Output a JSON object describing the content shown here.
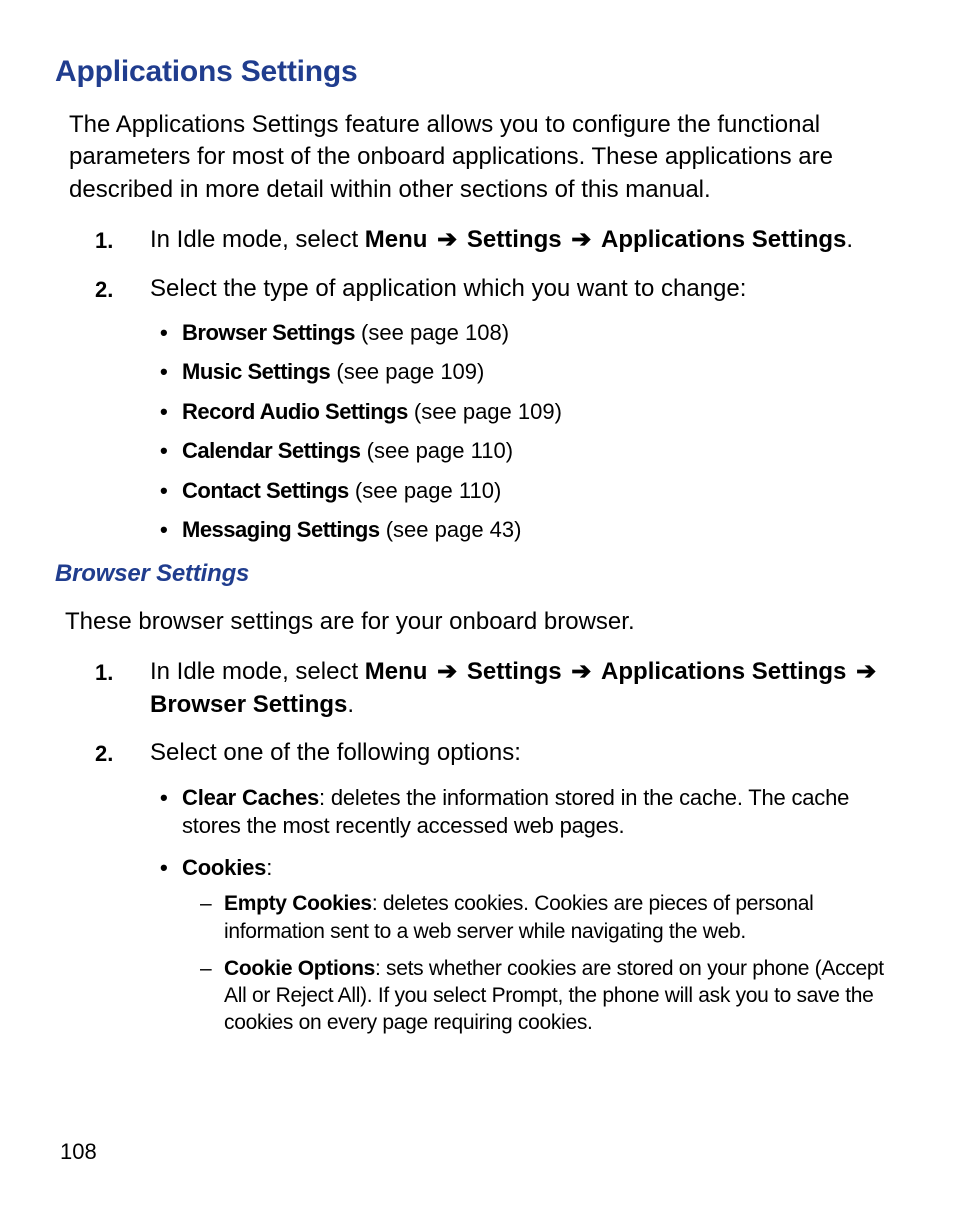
{
  "heading": "Applications Settings",
  "intro": "The Applications Settings feature allows you to configure the functional parameters for most of the onboard applications. These applications are described in more detail within other sections of this manual.",
  "arrow": "➔",
  "step1": {
    "num": "1.",
    "lead": "In Idle mode, select ",
    "menu": "Menu",
    "settings": "Settings",
    "apps": "Applications Settings",
    "tail": "."
  },
  "step2": {
    "num": "2.",
    "text": "Select the type of application which you want to change:"
  },
  "types": [
    {
      "name": "Browser Settings",
      "ref": " (see page 108)"
    },
    {
      "name": "Music Settings",
      "ref": " (see page 109)"
    },
    {
      "name": "Record Audio Settings",
      "ref": " (see page 109)"
    },
    {
      "name": "Calendar Settings",
      "ref": " (see page 110)"
    },
    {
      "name": "Contact Settings",
      "ref": " (see page 110)"
    },
    {
      "name": "Messaging Settings",
      "ref": " (see page 43)"
    }
  ],
  "subheading": "Browser Settings",
  "subintro": "These browser settings are for your onboard browser.",
  "bstep1": {
    "num": "1.",
    "lead": "In Idle mode, select ",
    "menu": "Menu",
    "settings": "Settings",
    "apps": "Applications Settings",
    "browser": "Browser Settings",
    "tail": "."
  },
  "bstep2": {
    "num": "2.",
    "text": "Select one of the following options:"
  },
  "opts": {
    "clear": {
      "name": "Clear Caches",
      "desc": ": deletes the information stored in the cache. The cache stores the most recently accessed web pages."
    },
    "cookies": {
      "name": "Cookies",
      "colon": ":"
    },
    "empty": {
      "name": "Empty Cookies",
      "desc": ": deletes cookies. Cookies are pieces of personal information sent to a web server while navigating the web."
    },
    "options": {
      "name": "Cookie Options",
      "desc": ": sets whether cookies are stored on your phone (Accept All or Reject All). If you select Prompt, the phone will ask you to save the cookies on every page requiring cookies."
    }
  },
  "pagenum": "108"
}
